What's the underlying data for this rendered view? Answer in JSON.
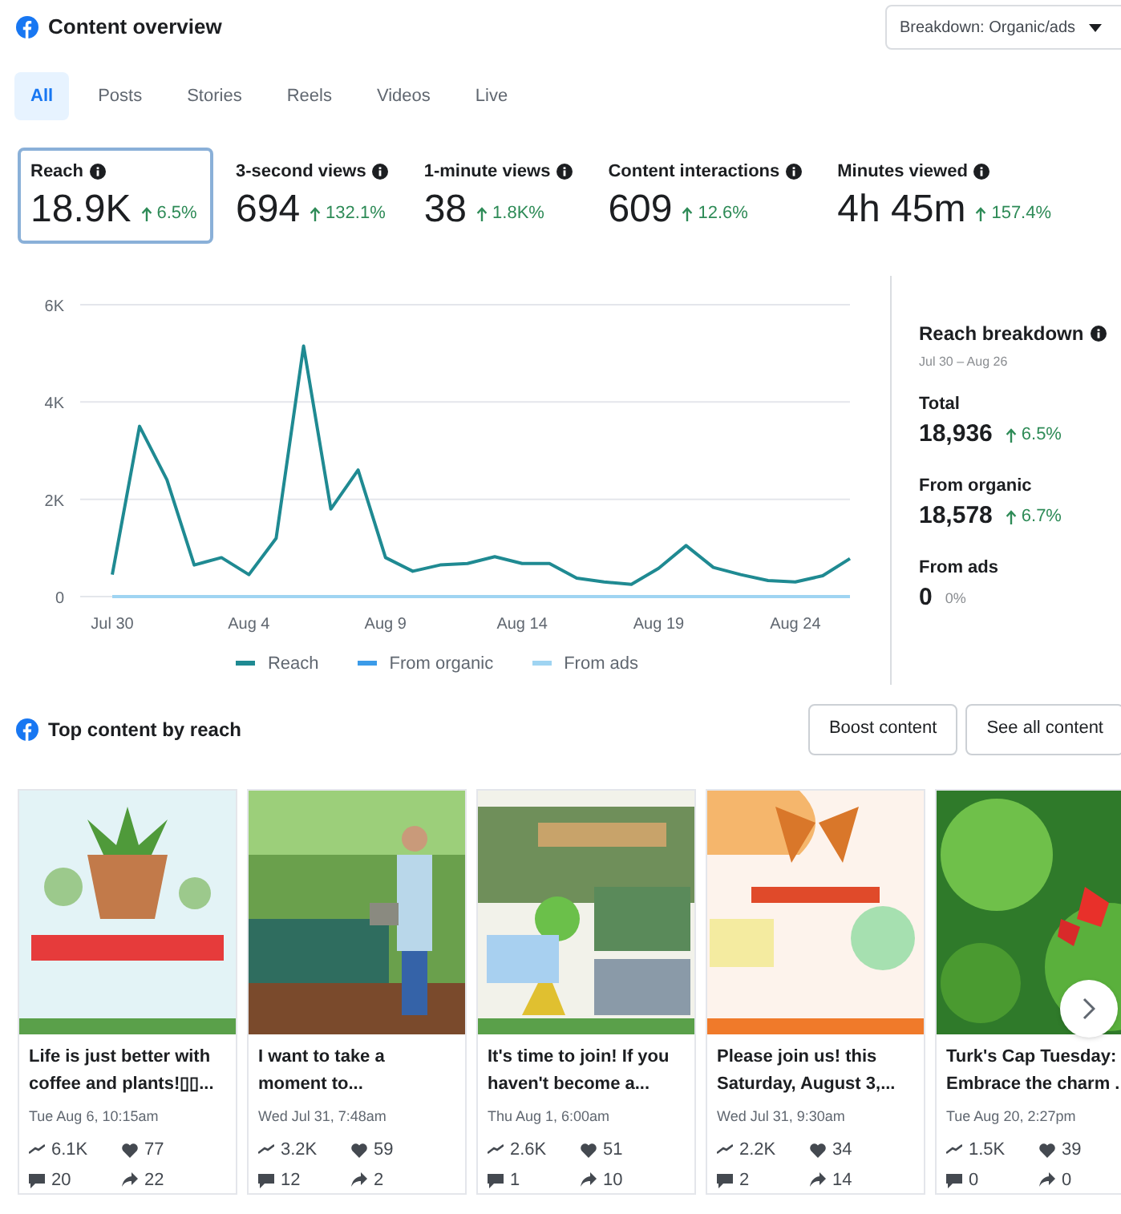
{
  "header": {
    "title": "Content overview",
    "dropdown": "Breakdown: Organic/ads"
  },
  "tabs": [
    {
      "label": "All",
      "selected": true
    },
    {
      "label": "Posts",
      "selected": false
    },
    {
      "label": "Stories",
      "selected": false
    },
    {
      "label": "Reels",
      "selected": false
    },
    {
      "label": "Videos",
      "selected": false
    },
    {
      "label": "Live",
      "selected": false
    }
  ],
  "metrics": [
    {
      "label": "Reach",
      "value": "18.9K",
      "change": "6.5%",
      "rising": true,
      "selected": true
    },
    {
      "label": "3-second views",
      "value": "694",
      "change": "132.1%",
      "rising": true,
      "selected": false
    },
    {
      "label": "1-minute views",
      "value": "38",
      "change": "1.8K%",
      "rising": true,
      "selected": false
    },
    {
      "label": "Content interactions",
      "value": "609",
      "change": "12.6%",
      "rising": true,
      "selected": false
    },
    {
      "label": "Minutes viewed",
      "value": "4h 45m",
      "change": "157.4%",
      "rising": true,
      "selected": false
    }
  ],
  "chart_data": {
    "type": "line",
    "legend": "bottom",
    "categories": [
      "Jul 30",
      null,
      null,
      null,
      null,
      "Aug 4",
      null,
      null,
      null,
      null,
      "Aug 9",
      null,
      null,
      null,
      null,
      "Aug 14",
      null,
      null,
      null,
      null,
      "Aug 19",
      null,
      null,
      null,
      null,
      "Aug 24",
      null,
      null
    ],
    "yticks": [
      {
        "value": 0,
        "label": "0"
      },
      {
        "value": 2000,
        "label": "2K"
      },
      {
        "value": 4000,
        "label": "4K"
      },
      {
        "value": 6000,
        "label": "6K"
      }
    ],
    "ylim": [
      0,
      6000
    ],
    "series": [
      {
        "name": "Reach",
        "color": "#1f8a92",
        "values": [
          450,
          3500,
          2400,
          650,
          800,
          450,
          1200,
          5150,
          1800,
          2600,
          800,
          520,
          650,
          680,
          820,
          680,
          680,
          380,
          300,
          250,
          580,
          1050,
          600,
          450,
          330,
          300,
          430,
          780
        ]
      },
      {
        "name": "From organic",
        "color": "#3b9be8",
        "values": [
          null,
          null,
          null,
          null,
          null,
          null,
          null,
          null,
          null,
          null,
          null,
          null,
          null,
          null,
          null,
          null,
          null,
          null,
          null,
          null,
          null,
          null,
          null,
          null,
          null,
          null,
          null,
          null
        ]
      },
      {
        "name": "From ads",
        "color": "#9fd4f2",
        "values": [
          0,
          0,
          0,
          0,
          0,
          0,
          0,
          0,
          0,
          0,
          0,
          0,
          0,
          0,
          0,
          0,
          0,
          0,
          0,
          0,
          0,
          0,
          0,
          0,
          0,
          0,
          0,
          0
        ]
      }
    ]
  },
  "breakdown": {
    "title": "Reach breakdown",
    "dates": "Jul 30 – Aug 26",
    "rows": [
      {
        "label": "Total",
        "value": "18,936",
        "change": "6.5%",
        "rising": true
      },
      {
        "label": "From organic",
        "value": "18,578",
        "change": "6.7%",
        "rising": true
      },
      {
        "label": "From ads",
        "value": "0",
        "change": "0%",
        "rising": false
      }
    ]
  },
  "top_content": {
    "title": "Top content by reach",
    "buttons": [
      "Boost content",
      "See all content"
    ],
    "posts": [
      {
        "text": "Life is just better with coffee and plants!▯▯...",
        "date": "Tue Aug 6, 10:15am",
        "reach": "6.1K",
        "likes": "77",
        "comments": "20",
        "shares": "22"
      },
      {
        "text": "I want to take a moment to...",
        "date": "Wed Jul 31, 7:48am",
        "reach": "3.2K",
        "likes": "59",
        "comments": "12",
        "shares": "2"
      },
      {
        "text": "It's time to join! If you haven't become a...",
        "date": "Thu Aug 1, 6:00am",
        "reach": "2.6K",
        "likes": "51",
        "comments": "1",
        "shares": "10"
      },
      {
        "text": "Please join us! this Saturday, August 3,...",
        "date": "Wed Jul 31, 9:30am",
        "reach": "2.2K",
        "likes": "34",
        "comments": "2",
        "shares": "14"
      },
      {
        "text": "Turk's Cap Tuesday: Embrace the charm .",
        "date": "Tue Aug 20, 2:27pm",
        "reach": "1.5K",
        "likes": "39",
        "comments": "0",
        "shares": "0"
      }
    ]
  }
}
